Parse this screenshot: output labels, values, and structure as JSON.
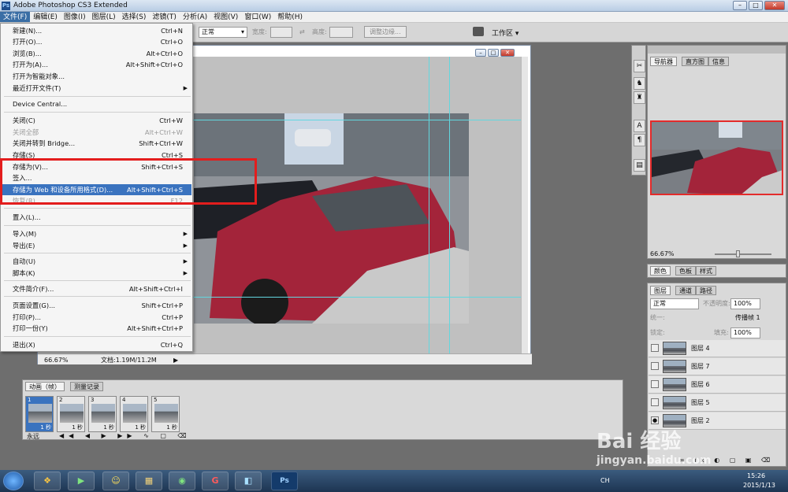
{
  "window": {
    "title": "Adobe Photoshop CS3 Extended",
    "logo": "Ps",
    "buttons": [
      "–",
      "□",
      "✕"
    ]
  },
  "menubar": [
    "文件(F)",
    "编辑(E)",
    "图像(I)",
    "图层(L)",
    "选择(S)",
    "滤镜(T)",
    "分析(A)",
    "视图(V)",
    "窗口(W)",
    "帮助(H)"
  ],
  "options": {
    "mode": "正常",
    "width_label": "宽度:",
    "height_label": "高度:",
    "refine_button": "调整边缘...",
    "workspace": "工作区 ▾"
  },
  "file_menu": [
    {
      "label": "新建(N)...",
      "shortcut": "Ctrl+N"
    },
    {
      "label": "打开(O)...",
      "shortcut": "Ctrl+O"
    },
    {
      "label": "浏览(B)...",
      "shortcut": "Alt+Ctrl+O"
    },
    {
      "label": "打开为(A)...",
      "shortcut": "Alt+Shift+Ctrl+O"
    },
    {
      "label": "打开为智能对象...",
      "shortcut": ""
    },
    {
      "label": "最近打开文件(T)",
      "shortcut": "",
      "submenu": true
    },
    {
      "label": "Device Central...",
      "shortcut": ""
    },
    {
      "label": "关闭(C)",
      "shortcut": "Ctrl+W"
    },
    {
      "label": "关闭全部",
      "shortcut": "Alt+Ctrl+W",
      "disabled": true
    },
    {
      "label": "关闭并转到 Bridge...",
      "shortcut": "Shift+Ctrl+W"
    },
    {
      "label": "存储(S)",
      "shortcut": "Ctrl+S"
    },
    {
      "label": "存储为(V)...",
      "shortcut": "Shift+Ctrl+S"
    },
    {
      "label": "签入...",
      "shortcut": ""
    },
    {
      "label": "存储为 Web 和设备所用格式(D)...",
      "shortcut": "Alt+Shift+Ctrl+S",
      "highlight": true
    },
    {
      "label": "恢复(R)",
      "shortcut": "F12",
      "disabled": true
    },
    {
      "label": "置入(L)...",
      "shortcut": ""
    },
    {
      "label": "导入(M)",
      "shortcut": "",
      "submenu": true
    },
    {
      "label": "导出(E)",
      "shortcut": "",
      "submenu": true
    },
    {
      "label": "自动(U)",
      "shortcut": "",
      "submenu": true
    },
    {
      "label": "脚本(K)",
      "shortcut": "",
      "submenu": true
    },
    {
      "label": "文件简介(F)...",
      "shortcut": "Alt+Shift+Ctrl+I"
    },
    {
      "label": "页面设置(G)...",
      "shortcut": "Shift+Ctrl+P"
    },
    {
      "label": "打印(P)...",
      "shortcut": "Ctrl+P"
    },
    {
      "label": "打印一份(Y)",
      "shortcut": "Alt+Shift+Ctrl+P"
    },
    {
      "label": "退出(X)",
      "shortcut": "Ctrl+Q"
    }
  ],
  "document": {
    "zoom": "66.67%",
    "status": "文档:1.19M/11.2M"
  },
  "navigator": {
    "tabs": [
      "导航器",
      "直方图",
      "信息"
    ],
    "zoom": "66.67%"
  },
  "color_panel": {
    "tabs": [
      "颜色",
      "色板",
      "样式"
    ]
  },
  "layers_panel": {
    "tabs": [
      "图层",
      "通道",
      "路径"
    ],
    "blend_mode": "正常",
    "opacity_label": "不透明度:",
    "opacity": "100%",
    "unify_label": "统一:",
    "propagate_label": "传播帧 1",
    "lock_label": "锁定:",
    "fill_label": "填充:",
    "fill": "100%",
    "layers": [
      {
        "name": "图层 4",
        "visible": false
      },
      {
        "name": "图层 7",
        "visible": false
      },
      {
        "name": "图层 6",
        "visible": false
      },
      {
        "name": "图层 5",
        "visible": false
      },
      {
        "name": "图层 2",
        "visible": true
      }
    ]
  },
  "animation_panel": {
    "tabs": [
      "动画（帧）",
      "测量记录"
    ],
    "frames": [
      {
        "num": "1",
        "time": "1 秒"
      },
      {
        "num": "2",
        "time": "1 秒"
      },
      {
        "num": "3",
        "time": "1 秒"
      },
      {
        "num": "4",
        "time": "1 秒"
      },
      {
        "num": "5",
        "time": "1 秒"
      }
    ],
    "loop": "永远"
  },
  "taskbar": {
    "ps_label": "Ps",
    "time": "15:26",
    "date": "2015/1/13",
    "ime": "CH"
  },
  "watermark": {
    "brand": "Bai 经验",
    "url": "jingyan.baidu.com"
  }
}
